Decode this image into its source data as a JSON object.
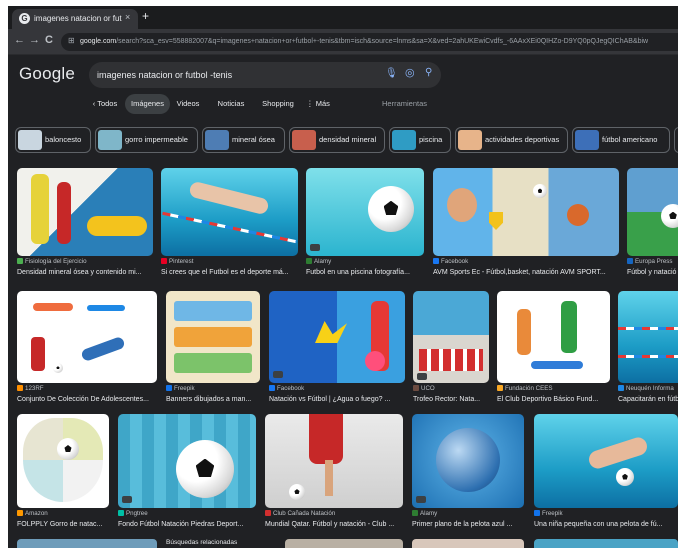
{
  "browser": {
    "tab_title": "imagenes natacion or futbol -t",
    "favicon": "G",
    "close_glyph": "×",
    "new_tab_glyph": "+",
    "nav_back": "←",
    "nav_forward": "→",
    "nav_reload": "C",
    "url_host": "google.com",
    "url_path": "/search?sca_esv=558882007&q=imagenes+natacion+or+futbol+-tenis&tbm=isch&source=lnms&sa=X&ved=2ahUKEwiCvdfs_-6AAxXEi0QIHZo-D9YQ0pQJegQIChAB&biw"
  },
  "google": {
    "logo": "Google",
    "query": "imagenes natacion or futbol -tenis"
  },
  "filters": {
    "back": "‹ Todos",
    "items": [
      "Imágenes",
      "Videos",
      "Noticias",
      "Shopping",
      "⋮ Más"
    ],
    "tools": "Herramientas"
  },
  "chips": [
    {
      "label": "baloncesto",
      "thumb": "#c9d6e0"
    },
    {
      "label": "gorro impermeable",
      "thumb": "#7fb6c9"
    },
    {
      "label": "mineral ósea",
      "thumb": "#4e7db4"
    },
    {
      "label": "densidad mineral",
      "thumb": "#c85f4d"
    },
    {
      "label": "piscina",
      "thumb": "#2f9cc4"
    },
    {
      "label": "actividades deportivas",
      "thumb": "#e7b48a"
    },
    {
      "label": "fútbol americano",
      "thumb": "#3d6fb8"
    }
  ],
  "results": {
    "row1": [
      {
        "source": "Fisiología del Ejercicio",
        "caption": "Densidad mineral ósea y contenido mi...",
        "icon_color": "#4caf50"
      },
      {
        "source": "Pinterest",
        "caption": "Si crees que el Futbol es el deporte má...",
        "icon_color": "#e60023"
      },
      {
        "source": "Alamy",
        "caption": "Futbol en una piscina fotografía...",
        "icon_color": "#2e7d32"
      },
      {
        "source": "Facebook",
        "caption": "AVM Sports Ec - Fútbol,basket, natación AVM SPORT...",
        "icon_color": "#1877f2"
      },
      {
        "source": "Europa Press",
        "caption": "Fútbol y natació",
        "icon_color": "#1565c0"
      }
    ],
    "row2": [
      {
        "source": "123RF",
        "caption": "Conjunto De Colección De Adolescentes...",
        "icon_color": "#ff8f00"
      },
      {
        "source": "Freepik",
        "caption": "Banners dibujados a man...",
        "icon_color": "#1273eb"
      },
      {
        "source": "Facebook",
        "caption": "Natación vs Fútbol | ¿Agua o fuego? ...",
        "icon_color": "#1877f2"
      },
      {
        "source": "UCO",
        "caption": "Trofeo Rector: Nata...",
        "icon_color": "#6d4c41"
      },
      {
        "source": "Fundación CEES",
        "caption": "El Club Deportivo Básico Fund...",
        "icon_color": "#f9a825"
      },
      {
        "source": "Neuquén Informa",
        "caption": "Capacitarán en fútb",
        "icon_color": "#1e88e5"
      }
    ],
    "row3": [
      {
        "source": "Amazon",
        "caption": "FOLPPLY Gorro de natac...",
        "icon_color": "#ff9900"
      },
      {
        "source": "Pngtree",
        "caption": "Fondo Fútbol Natación Piedras Deport...",
        "icon_color": "#00bfa5"
      },
      {
        "source": "Club Cañada Natación",
        "caption": "Mundial Qatar. Fútbol y natación - Club ...",
        "icon_color": "#d32f2f"
      },
      {
        "source": "Alamy",
        "caption": "Primer plano de la pelota azul ...",
        "icon_color": "#2e7d32"
      },
      {
        "source": "Freepik",
        "caption": "Una niña pequeña con una pelota de fú...",
        "icon_color": "#1273eb"
      }
    ],
    "related_label": "Búsquedas relacionadas"
  },
  "colors": {
    "page_bg": "#202124",
    "accent": "#8ab4f8",
    "active_pill": "#3c4043"
  }
}
